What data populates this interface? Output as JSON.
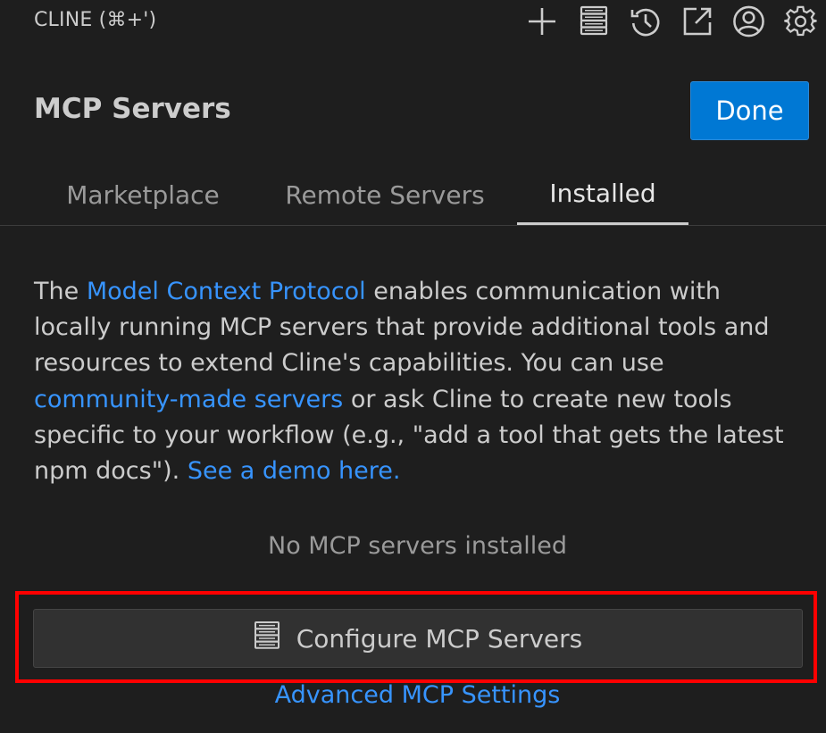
{
  "header": {
    "app_title": "CLINE (⌘+')",
    "icons": [
      "plus-icon",
      "server-stack-icon",
      "history-icon",
      "popout-icon",
      "account-icon",
      "gear-icon"
    ]
  },
  "view": {
    "title": "MCP Servers",
    "done_label": "Done"
  },
  "tabs": [
    {
      "label": "Marketplace",
      "active": false
    },
    {
      "label": "Remote Servers",
      "active": false
    },
    {
      "label": "Installed",
      "active": true
    }
  ],
  "description": {
    "part1": "The ",
    "link1": "Model Context Protocol",
    "part2": " enables communication with locally running MCP servers that provide additional tools and resources to extend Cline's capabilities. You can use ",
    "link2": "community-made servers",
    "part3": " or ask Cline to create new tools specific to your workflow (e.g., \"add a tool that gets the latest npm docs\"). ",
    "link3": "See a demo here."
  },
  "empty_state": "No MCP servers installed",
  "configure_button": {
    "label": "Configure MCP Servers",
    "icon": "server-stack-icon"
  },
  "advanced_link": "Advanced MCP Settings",
  "colors": {
    "background": "#1e1e1e",
    "accent": "#0078d4",
    "link": "#3794ff",
    "highlight": "#ff0000"
  }
}
